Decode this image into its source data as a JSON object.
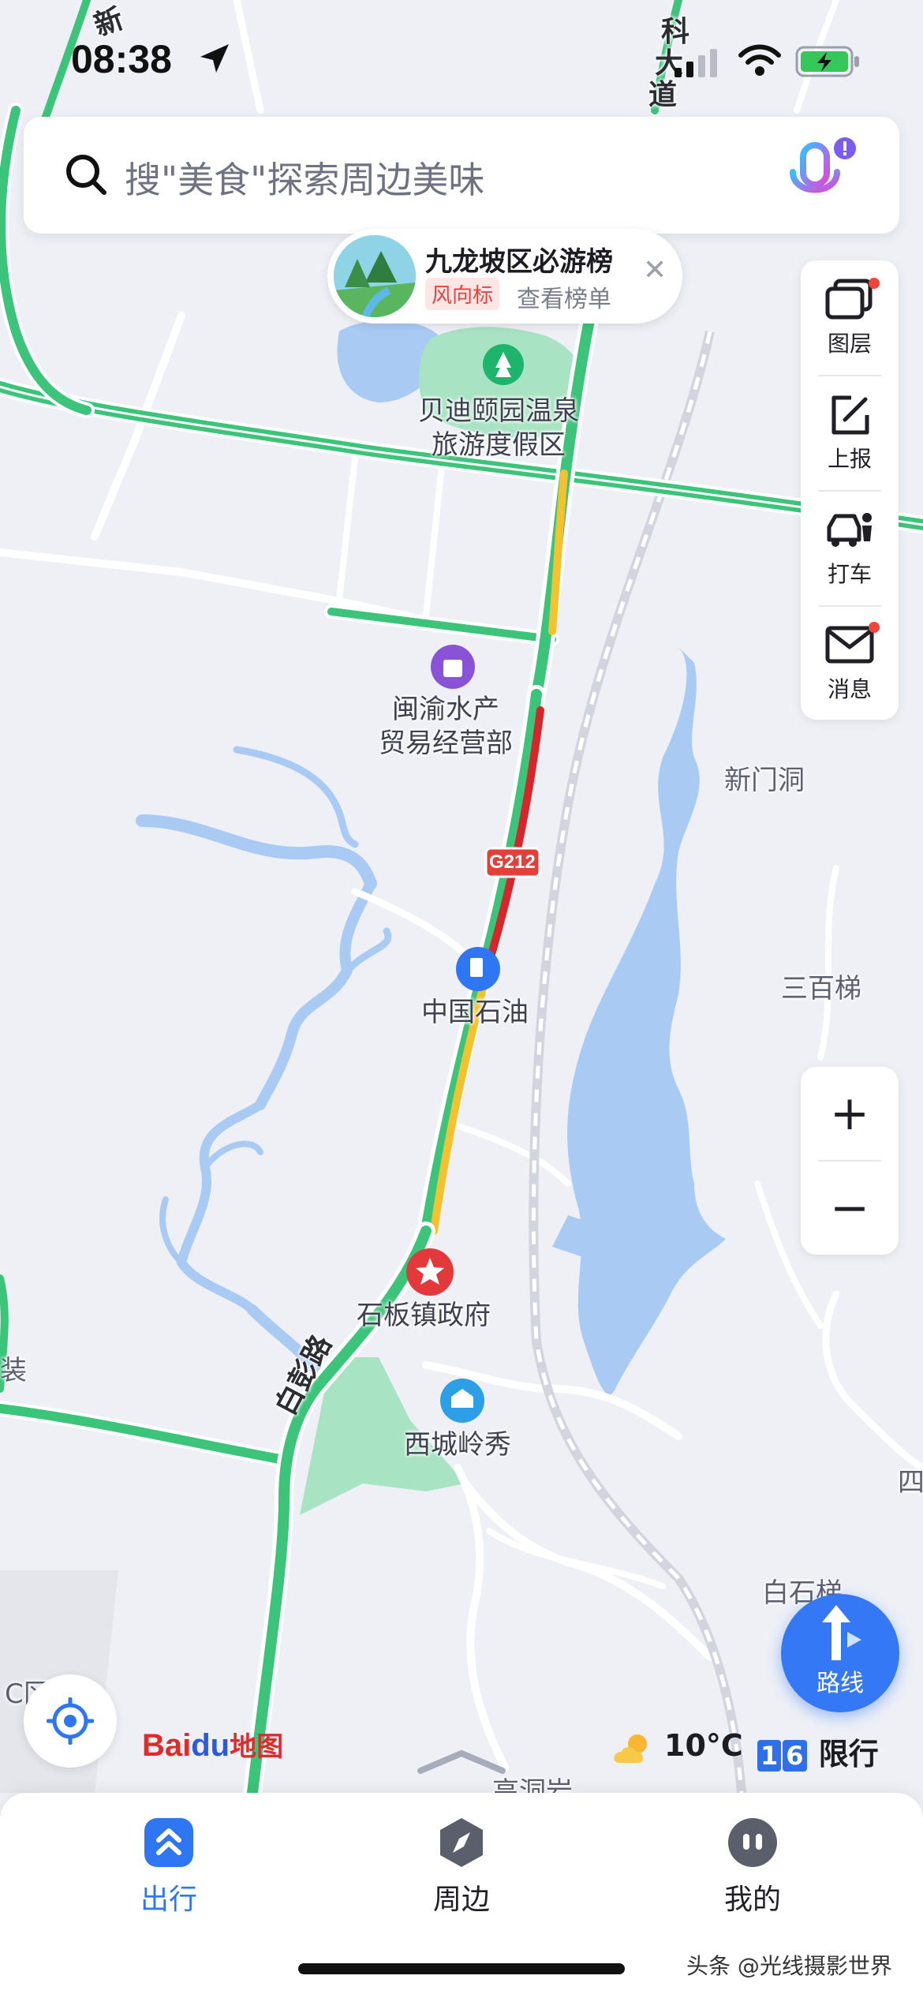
{
  "status_bar": {
    "time": "08:38"
  },
  "search": {
    "placeholder": "搜\"美食\"探索周边美味"
  },
  "rank_card": {
    "title": "九龙坡区必游榜",
    "tag": "风向标",
    "link": "查看榜单"
  },
  "tools": [
    {
      "label": "图层",
      "icon": "layers-icon",
      "badge": true
    },
    {
      "label": "上报",
      "icon": "report-icon",
      "badge": false
    },
    {
      "label": "打车",
      "icon": "taxi-icon",
      "badge": false
    },
    {
      "label": "消息",
      "icon": "message-icon",
      "badge": true
    }
  ],
  "zoom": {
    "in": "+",
    "out": "−"
  },
  "map_labels": {
    "poi_resort_line1": "贝迪颐园温泉",
    "poi_resort_line2": "旅游度假区",
    "poi_seafood_line1": "闽渝水产",
    "poi_seafood_line2": "贸易经营部",
    "road_shield": "G212",
    "poi_petro": "中国石油",
    "poi_gov": "石板镇政府",
    "poi_xicheng": "西城岭秀",
    "place_xinmendong": "新门洞",
    "place_sanbaiti": "三百梯",
    "place_baishiti": "白石梯",
    "road_baipeng": "白彭路",
    "road_keji_1": "科",
    "road_keji_2": "大",
    "road_keji_3": "道",
    "road_xin": "新",
    "place_gaodongyan": "高洞岩",
    "edge_zhuang": "装",
    "edge_si": "四",
    "edge_ce": "C区"
  },
  "logo": {
    "bai": "Bai",
    "du": "du",
    "tu": "地图"
  },
  "route_button": {
    "label": "路线"
  },
  "weather": {
    "temperature": "10°C"
  },
  "traffic_limit": {
    "digit1": "1",
    "digit2": "6",
    "label": "限行"
  },
  "bottom_nav": [
    {
      "label": "出行",
      "icon": "travel-icon",
      "active": true
    },
    {
      "label": "周边",
      "icon": "compass-icon",
      "active": false
    },
    {
      "label": "我的",
      "icon": "profile-icon",
      "active": false
    }
  ],
  "watermark": "头条 @光线摄影世界",
  "colors": {
    "map_bg": "#eef0f6",
    "water": "#a9cbf3",
    "park": "#a8e3c3",
    "road_green": "#3cc47a",
    "road_yellow": "#f2c230",
    "road_red": "#d7262b",
    "accent": "#2f77f2"
  }
}
